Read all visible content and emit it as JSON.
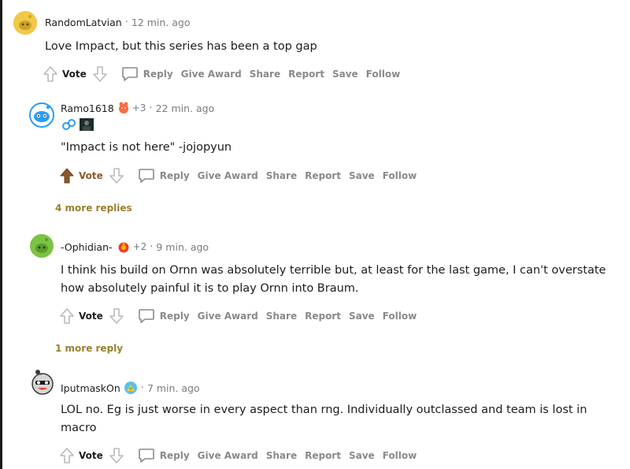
{
  "comments": [
    {
      "username": "RandomLatvian",
      "time": "12 min. ago",
      "karma": "",
      "body": [
        "Love Impact, but this series has been a top gap"
      ],
      "vote_label": "Vote",
      "upvoted": false
    },
    {
      "username": "Ramo1618",
      "time": "22 min. ago",
      "karma": "+3",
      "body": [
        "\"Impact is not here\" -jojopyun"
      ],
      "vote_label": "Vote",
      "upvoted": true
    },
    {
      "username": "-Ophidian-",
      "time": "9 min. ago",
      "karma": "+2",
      "body": [
        "I think his build on Ornn was absolutely terrible but, at least for the last game, I can't overstate",
        "how absolutely painful it is to play Ornn into Braum."
      ],
      "vote_label": "Vote",
      "upvoted": false
    },
    {
      "username": "IputmaskOn",
      "time": "7 min. ago",
      "karma": "",
      "body": [
        "LOL no. Eg is just worse in every aspect than rng. Individually outclassed and team is lost in",
        "macro"
      ],
      "vote_label": "Vote",
      "upvoted": false
    }
  ],
  "actions": {
    "reply": "Reply",
    "give_award": "Give Award",
    "share": "Share",
    "report": "Report",
    "save": "Save",
    "follow": "Follow"
  },
  "more_replies": {
    "ramo": "4 more replies",
    "ophidian": "1 more reply"
  },
  "separator": "·",
  "colors": {
    "upvote_active": "#8b5a2b",
    "more_replies": "#997f2e",
    "muted": "#878a8c"
  }
}
